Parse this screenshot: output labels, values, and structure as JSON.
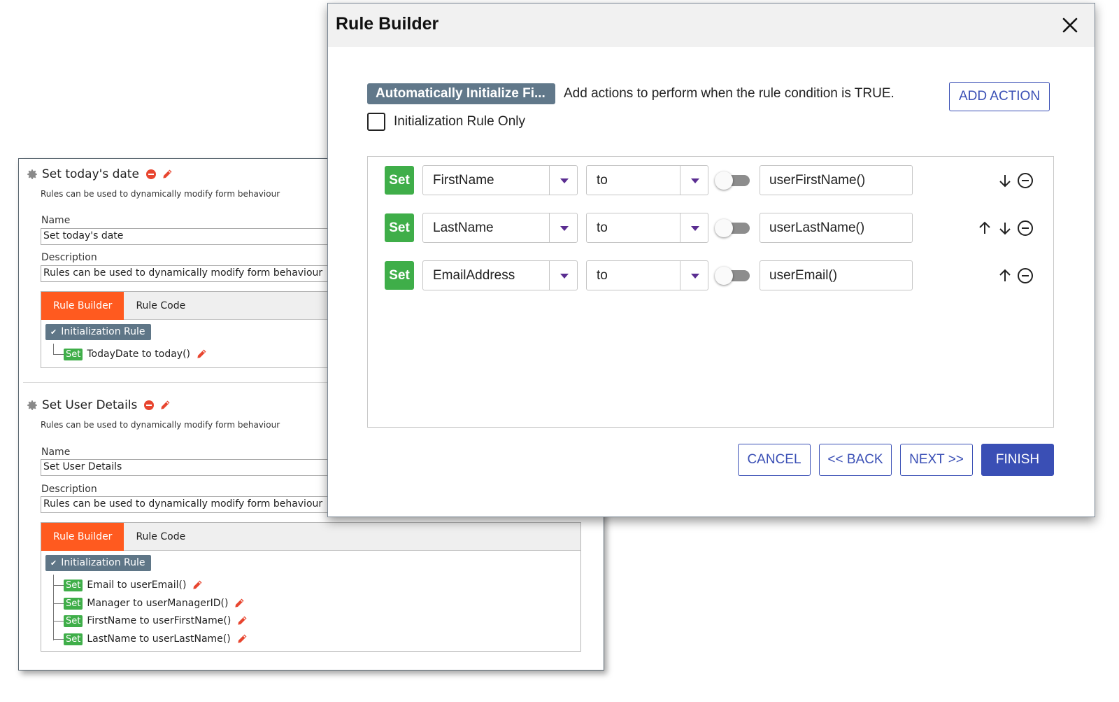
{
  "rules_panel": {
    "rules": [
      {
        "title": "Set today's date",
        "subtitle": "Rules can be used to dynamically modify form behaviour",
        "name_label": "Name",
        "name_value": "Set today's date",
        "description_label": "Description",
        "description_value": "Rules can be used to dynamically modify form behaviour",
        "tabs": [
          "Rule Builder",
          "Rule Code"
        ],
        "active_tab": "Rule Builder",
        "initialization_badge": "Initialization Rule",
        "items": [
          {
            "badge": "Set",
            "text": "TodayDate to today()"
          }
        ]
      },
      {
        "title": "Set User Details",
        "subtitle": "Rules can be used to dynamically modify form behaviour",
        "name_label": "Name",
        "name_value": "Set User Details",
        "description_label": "Description",
        "description_value": "Rules can be used to dynamically modify form behaviour",
        "tabs": [
          "Rule Builder",
          "Rule Code"
        ],
        "active_tab": "Rule Builder",
        "initialization_badge": "Initialization Rule",
        "items": [
          {
            "badge": "Set",
            "text": "Email to userEmail()"
          },
          {
            "badge": "Set",
            "text": "Manager to userManagerID()"
          },
          {
            "badge": "Set",
            "text": "FirstName to userFirstName()"
          },
          {
            "badge": "Set",
            "text": "LastName to userLastName()"
          }
        ]
      }
    ]
  },
  "dialog": {
    "title": "Rule Builder",
    "rule_badge": "Automatically Initialize Fi...",
    "description": "Add actions to perform when the rule condition is TRUE.",
    "add_action_label": "ADD ACTION",
    "initialization_only_label": "Initialization Rule Only",
    "initialization_only_checked": false,
    "actions": [
      {
        "verb": "Set",
        "field": "FirstName",
        "operator": "to",
        "toggle_on": false,
        "value": "userFirstName()",
        "icons": [
          "arrow-down-icon",
          "remove-circle-icon"
        ]
      },
      {
        "verb": "Set",
        "field": "LastName",
        "operator": "to",
        "toggle_on": false,
        "value": "userLastName()",
        "icons": [
          "arrow-up-icon",
          "arrow-down-icon",
          "remove-circle-icon"
        ]
      },
      {
        "verb": "Set",
        "field": "EmailAddress",
        "operator": "to",
        "toggle_on": false,
        "value": "userEmail()",
        "icons": [
          "arrow-up-icon",
          "remove-circle-icon"
        ]
      }
    ],
    "buttons": {
      "cancel": "CANCEL",
      "back": "<< BACK",
      "next": "NEXT >>",
      "finish": "FINISH"
    }
  },
  "colors": {
    "accent_orange": "#ff5a1f",
    "set_green": "#3fae49",
    "badge_slate": "#61788a",
    "primary_blue": "#3a4fb5",
    "remove_red": "#e8452f"
  }
}
